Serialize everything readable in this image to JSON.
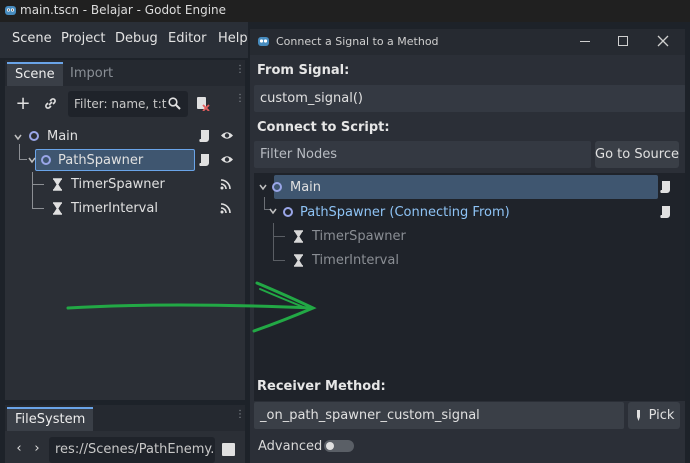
{
  "window": {
    "title": "main.tscn - Belajar - Godot Engine"
  },
  "menubar": {
    "items": [
      "Scene",
      "Project",
      "Debug",
      "Editor",
      "Help"
    ]
  },
  "scene_dock": {
    "tabs": [
      "Scene",
      "Import"
    ],
    "filter_placeholder": "Filter: name, t:t",
    "tree": [
      {
        "label": "Main",
        "icon": "node2d-circle-icon"
      },
      {
        "label": "PathSpawner",
        "icon": "node2d-circle-icon",
        "selected": true
      },
      {
        "label": "TimerSpawner",
        "icon": "hourglass-icon"
      },
      {
        "label": "TimerInterval",
        "icon": "hourglass-icon"
      }
    ]
  },
  "filesystem_dock": {
    "tab": "FileSystem",
    "path": "res://Scenes/PathEnemy.gd"
  },
  "dialog": {
    "title": "Connect a Signal to a Method",
    "from_signal_label": "From Signal:",
    "from_signal_value": "custom_signal()",
    "connect_to_script_label": "Connect to Script:",
    "filter_nodes_placeholder": "Filter Nodes",
    "go_to_source_label": "Go to Source",
    "tree": [
      {
        "label": "Main",
        "icon": "node2d-circle-icon",
        "selected": true
      },
      {
        "label": "PathSpawner (Connecting From)",
        "icon": "node2d-circle-icon",
        "highlight": true
      },
      {
        "label": "TimerSpawner",
        "icon": "hourglass-icon",
        "dimmed": true
      },
      {
        "label": "TimerInterval",
        "icon": "hourglass-icon",
        "dimmed": true
      }
    ],
    "receiver_method_label": "Receiver Method:",
    "receiver_method_value": "_on_path_spawner_custom_signal",
    "pick_label": "Pick",
    "advanced_label": "Advanced",
    "advanced_enabled": false
  },
  "colors": {
    "accent": "#6aa4e8",
    "selection": "#3f5670",
    "annotation_arrow": "#22a845",
    "connecting_from_text": "#8ec3f5"
  }
}
